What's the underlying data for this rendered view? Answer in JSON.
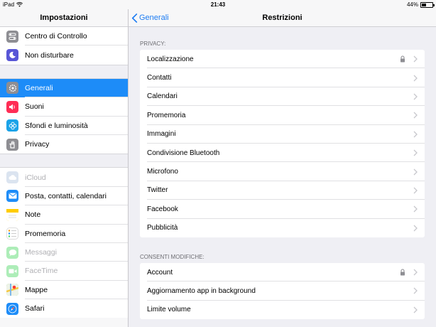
{
  "status": {
    "device": "iPad",
    "time": "21:43",
    "battery": "44%",
    "battery_level": 0.44
  },
  "sidebar": {
    "title": "Impostazioni",
    "groups": [
      [
        {
          "label": "Centro di Controllo",
          "icon": "control-center-icon",
          "color": "#8e8e93"
        },
        {
          "label": "Non disturbare",
          "icon": "moon-icon",
          "color": "#5856d6"
        }
      ],
      [
        {
          "label": "Generali",
          "icon": "gear-icon",
          "color": "#8e8e93",
          "active": true
        },
        {
          "label": "Suoni",
          "icon": "speaker-icon",
          "color": "#ff2d55"
        },
        {
          "label": "Sfondi e luminosità",
          "icon": "flower-icon",
          "color": "#1aa3e8"
        },
        {
          "label": "Privacy",
          "icon": "hand-icon",
          "color": "#8e8e93"
        }
      ],
      [
        {
          "label": "iCloud",
          "icon": "cloud-icon",
          "color": "#b0c4de",
          "dim": true
        },
        {
          "label": "Posta, contatti, calendari",
          "icon": "mail-icon",
          "color": "#1d8cf8"
        },
        {
          "label": "Note",
          "icon": "notes-icon",
          "color": "#ffcc00"
        },
        {
          "label": "Promemoria",
          "icon": "reminders-icon",
          "color": "#ffffff"
        },
        {
          "label": "Messaggi",
          "icon": "messages-icon",
          "color": "#4cd964",
          "dim": true
        },
        {
          "label": "FaceTime",
          "icon": "facetime-icon",
          "color": "#4cd964",
          "dim": true
        },
        {
          "label": "Mappe",
          "icon": "maps-icon",
          "color": "#6bbf59"
        },
        {
          "label": "Safari",
          "icon": "compass-icon",
          "color": "#1d8cf8"
        }
      ]
    ]
  },
  "main": {
    "back_label": "Generali",
    "title": "Restrizioni",
    "sections": [
      {
        "header": "PRIVACY:",
        "rows": [
          {
            "label": "Localizzazione",
            "locked": true
          },
          {
            "label": "Contatti"
          },
          {
            "label": "Calendari"
          },
          {
            "label": "Promemoria"
          },
          {
            "label": "Immagini"
          },
          {
            "label": "Condivisione Bluetooth"
          },
          {
            "label": "Microfono"
          },
          {
            "label": "Twitter"
          },
          {
            "label": "Facebook"
          },
          {
            "label": "Pubblicità"
          }
        ]
      },
      {
        "header": "CONSENTI MODIFICHE:",
        "rows": [
          {
            "label": "Account",
            "locked": true
          },
          {
            "label": "Aggiornamento app in background"
          },
          {
            "label": "Limite volume"
          }
        ]
      }
    ]
  }
}
